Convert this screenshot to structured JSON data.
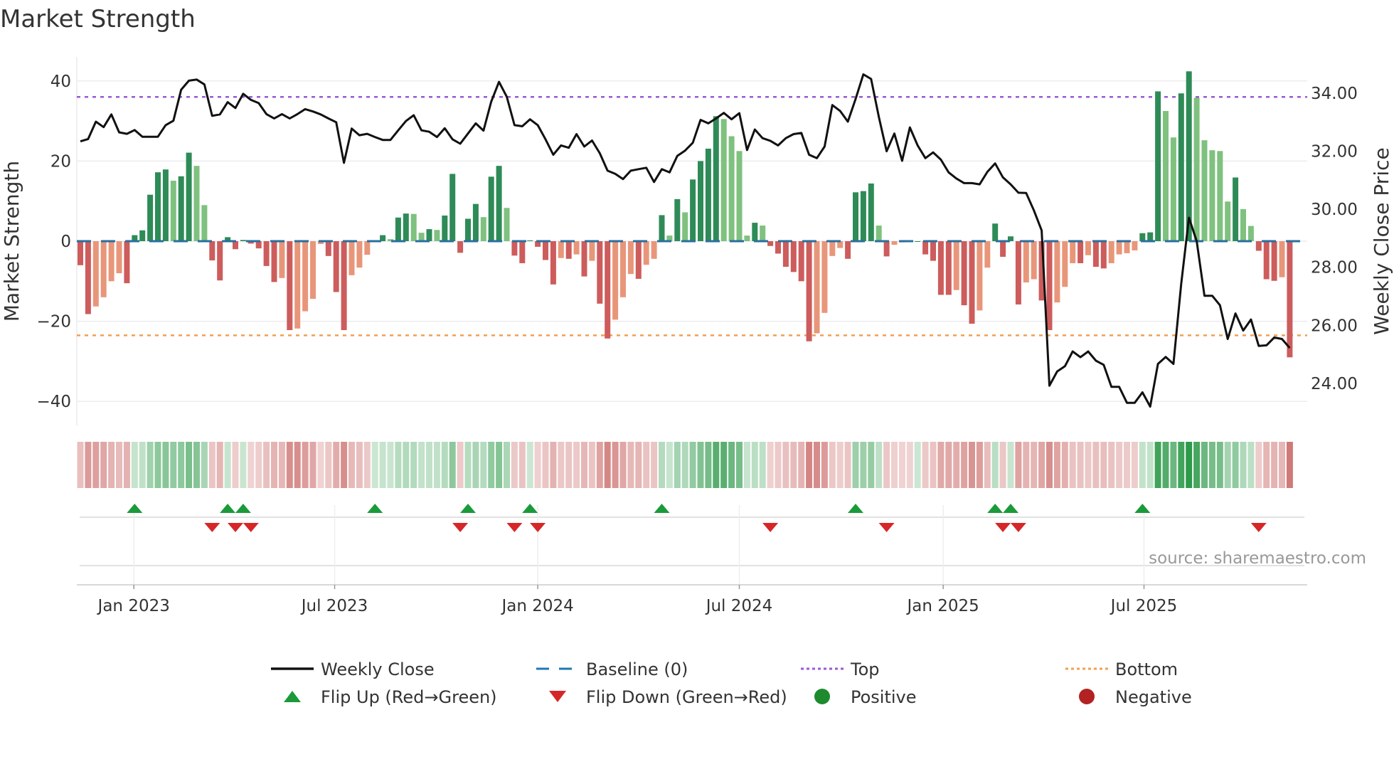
{
  "chart_data": {
    "type": "bar",
    "title": "Market Strength",
    "ylabel": "Market Strength",
    "y2label": "Weekly Close Price",
    "ylim": [
      -46,
      46
    ],
    "y2lim": [
      22.55,
      35.25
    ],
    "yticks": [
      40,
      20,
      0,
      -20,
      -40
    ],
    "yticklabels": [
      "40",
      "20",
      "0",
      "−20",
      "−40"
    ],
    "y2ticks": [
      34,
      32,
      30,
      28,
      26,
      24
    ],
    "y2ticklabels": [
      "34.00",
      "32.00",
      "30.00",
      "28.00",
      "26.00",
      "24.00"
    ],
    "xticks": [
      {
        "week": 6.9,
        "label": "Jan 2023"
      },
      {
        "week": 32.8,
        "label": "Jul 2023"
      },
      {
        "week": 59.0,
        "label": "Jan 2024"
      },
      {
        "week": 85.0,
        "label": "Jul 2024"
      },
      {
        "week": 111.3,
        "label": "Jan 2025"
      },
      {
        "week": 137.2,
        "label": "Jul 2025"
      }
    ],
    "top_threshold": 36,
    "bottom_threshold": -23.5,
    "baseline": 0,
    "strength": [
      -6,
      -18.2,
      -16.3,
      -14,
      -10,
      -8,
      -10.5,
      1.5,
      2.7,
      11.6,
      17.2,
      17.9,
      15.1,
      16.2,
      22.1,
      18.8,
      9,
      -4.8,
      -9.8,
      1,
      -2,
      0.3,
      -0.6,
      -1.8,
      -6.2,
      -10.2,
      -9.2,
      -22.2,
      -21.8,
      -17.5,
      -14.4,
      -0.7,
      -3.7,
      -12.7,
      -22.2,
      -8.5,
      -6.6,
      -3.4,
      0.2,
      1.5,
      0.5,
      5.9,
      6.9,
      6.8,
      2.1,
      3,
      2.8,
      6.4,
      16.8,
      -2.9,
      5.6,
      9.3,
      6,
      16.1,
      18.8,
      8.3,
      -3.6,
      -5.5,
      0.2,
      -1.4,
      -4.7,
      -10.8,
      -4.2,
      -4.4,
      -3.3,
      -8.8,
      -4.9,
      -15.6,
      -24.3,
      -19.6,
      -14,
      -8.2,
      -9.4,
      -5.9,
      -4.4,
      6.5,
      1.4,
      10.5,
      7.2,
      15.4,
      20,
      23.1,
      31.2,
      30.5,
      26.2,
      22.5,
      1.4,
      4.6,
      3.9,
      -1.2,
      -3.1,
      -6.4,
      -7.7,
      -10,
      -25,
      -23,
      -17.9,
      -3.7,
      -1.7,
      -4.4,
      12.2,
      12.5,
      14.4,
      3.9,
      -3.8,
      -0.9,
      -0.3,
      -0.2,
      0,
      -3.3,
      -4.9,
      -13.4,
      -13.4,
      -12.2,
      -16,
      -20.6,
      -17.3,
      -6.6,
      4.4,
      -3.9,
      1.2,
      -15.8,
      -10.3,
      -9.5,
      -14.8,
      -22.2,
      -15.3,
      -11.4,
      -5.5,
      -5.5,
      -3.5,
      -6.4,
      -6.8,
      -5.5,
      -3.3,
      -3,
      -2.3,
      2,
      2.2,
      37.4,
      32.5,
      25.9,
      36.9,
      42.4,
      35.8,
      25.2,
      22.7,
      22.5,
      9.9,
      15.9,
      8,
      3.8,
      -2.4,
      -9.5,
      -9.9,
      -9,
      -29
    ],
    "weekly_close": [
      32.34,
      32.42,
      33.02,
      32.83,
      33.27,
      32.65,
      32.6,
      32.73,
      32.5,
      32.5,
      32.5,
      32.9,
      33.05,
      34.12,
      34.43,
      34.47,
      34.3,
      33.22,
      33.27,
      33.69,
      33.49,
      33.98,
      33.77,
      33.66,
      33.28,
      33.13,
      33.28,
      33.13,
      33.28,
      33.45,
      33.37,
      33.27,
      33.13,
      33,
      31.6,
      32.78,
      32.55,
      32.6,
      32.49,
      32.39,
      32.39,
      32.72,
      33.04,
      33.24,
      32.72,
      32.67,
      32.49,
      32.79,
      32.41,
      32.26,
      32.61,
      32.96,
      32.71,
      33.71,
      34.39,
      33.88,
      32.9,
      32.86,
      33.1,
      32.9,
      32.41,
      31.88,
      32.2,
      32.12,
      32.59,
      32.16,
      32.37,
      31.93,
      31.33,
      31.22,
      31.04,
      31.33,
      31.38,
      31.43,
      30.94,
      31.38,
      31.27,
      31.84,
      32.02,
      32.29,
      33.08,
      32.96,
      33.13,
      33.32,
      33.1,
      33.31,
      32.04,
      32.75,
      32.45,
      32.36,
      32.2,
      32.45,
      32.59,
      32.63,
      31.88,
      31.76,
      32.16,
      33.59,
      33.39,
      33.02,
      33.8,
      34.65,
      34.49,
      33.18,
      32,
      32.61,
      31.67,
      32.82,
      32.2,
      31.76,
      31.96,
      31.71,
      31.27,
      31.06,
      30.9,
      30.9,
      30.86,
      31.29,
      31.58,
      31.1,
      30.86,
      30.57,
      30.56,
      29.96,
      29.27,
      23.92,
      24.41,
      24.59,
      25.1,
      24.9,
      25.1,
      24.78,
      24.64,
      23.88,
      23.88,
      23.33,
      23.33,
      23.69,
      23.2,
      24.67,
      24.91,
      24.67,
      27.43,
      29.71,
      28.9,
      27.02,
      27.02,
      26.69,
      25.53,
      26.41,
      25.82,
      26.2,
      25.29,
      25.31,
      25.58,
      25.53,
      25.22
    ],
    "flip_up_weeks": [
      7,
      19,
      21,
      38,
      50,
      58,
      75,
      100,
      118,
      120,
      137
    ],
    "flip_down_weeks": [
      17,
      20,
      22,
      49,
      56,
      59,
      89,
      104,
      119,
      121,
      152
    ],
    "legend": [
      {
        "label": "Weekly Close",
        "kind": "line",
        "color": "#111111"
      },
      {
        "label": "Baseline (0)",
        "kind": "dash",
        "color": "#1f77b4"
      },
      {
        "label": "Top",
        "kind": "dot",
        "color": "#9b59d6"
      },
      {
        "label": "Bottom",
        "kind": "dot",
        "color": "#f0a050"
      },
      {
        "label": "Flip Up (Red→Green)",
        "kind": "tri-up",
        "color": "#1a9a3a"
      },
      {
        "label": "Flip Down (Green→Red)",
        "kind": "tri-down",
        "color": "#d62728"
      },
      {
        "label": "Positive",
        "kind": "circle",
        "color": "#1e8a2e"
      },
      {
        "label": "Negative",
        "kind": "circle",
        "color": "#b22222"
      }
    ],
    "legend_position": "bottom"
  },
  "colors": {
    "pos_strong": "#2e8b57",
    "pos_weak": "#7fc17f",
    "neg_strong": "#cd5c5c",
    "neg_weak": "#e8967a"
  },
  "source": "source: sharemaestro.com"
}
